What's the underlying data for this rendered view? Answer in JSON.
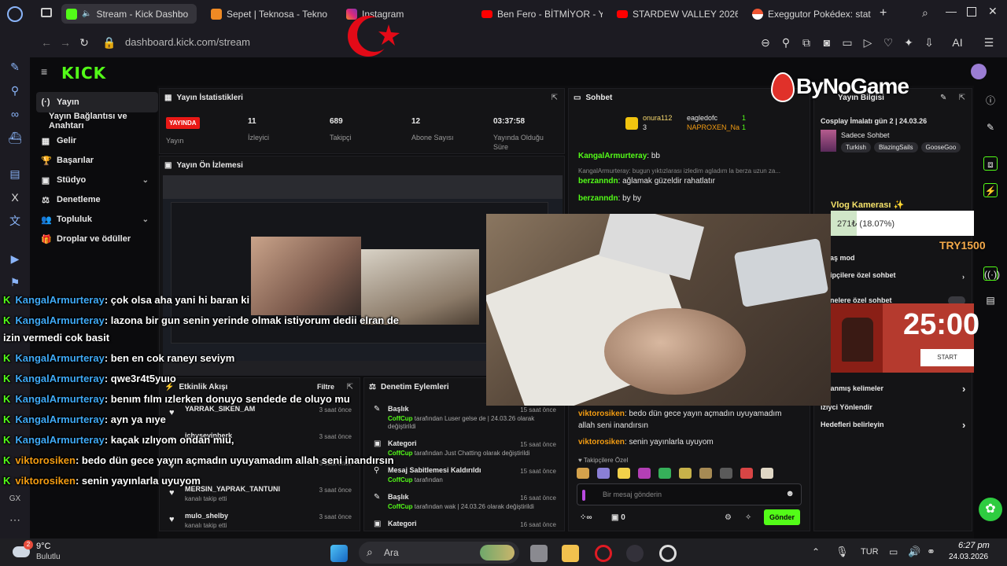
{
  "browser": {
    "tabs": [
      {
        "title": "Stream - Kick Dashbo",
        "active": true
      },
      {
        "title": "Sepet | Teknosa - Tekno"
      },
      {
        "title": "Instagram"
      },
      {
        "title": "Ben Fero - BİTMİYOR - Y"
      },
      {
        "title": "STARDEW VALLEY 2026"
      },
      {
        "title": "Exeggutor Pokédex: stat"
      }
    ],
    "url": "dashboard.kick.com/stream",
    "ai_label": "AI"
  },
  "kick": {
    "logo": "KICK",
    "nav": [
      {
        "label": "Yayın",
        "icon": "(·)",
        "active": true
      },
      {
        "label": "Yayın Bağlantısı ve Anahtarı",
        "icon": ""
      },
      {
        "label": "Gelir",
        "icon": "▦"
      },
      {
        "label": "Başarılar",
        "icon": "🏆"
      },
      {
        "label": "Stüdyo",
        "icon": "▣",
        "chevron": true
      },
      {
        "label": "Denetleme",
        "icon": "⚖"
      },
      {
        "label": "Topluluk",
        "icon": "👥",
        "chevron": true
      },
      {
        "label": "Droplar ve ödüller",
        "icon": "🎁"
      }
    ]
  },
  "stats": {
    "title": "Yayın İstatistikleri",
    "live_badge": "YAYINDA",
    "live_label": "Yayın",
    "items": [
      {
        "value": "11",
        "label": "İzleyici"
      },
      {
        "value": "689",
        "label": "Takipçi"
      },
      {
        "value": "12",
        "label": "Abone Sayısı"
      },
      {
        "value": "03:37:58",
        "label": "Yayında Olduğu Süre"
      }
    ]
  },
  "preview": {
    "title": "Yayın Ön İzlemesi"
  },
  "activity": {
    "title": "Etkinlik Akışı",
    "filter": "Filtre",
    "rows": [
      {
        "name": "YARRAK_SIKEN_AM",
        "sub": "",
        "time": "3 saat önce"
      },
      {
        "name": "ichyseyinberk",
        "sub": "",
        "time": "3 saat önce"
      },
      {
        "name": "",
        "sub": "",
        "time": "3 saat önce"
      },
      {
        "name": "MERSIN_YAPRAK_TANTUNI",
        "sub": "kanalı takip etti",
        "time": "3 saat önce"
      },
      {
        "name": "mulo_shelby",
        "sub": "kanalı takip etti",
        "time": "3 saat önce"
      }
    ]
  },
  "moderation": {
    "title": "Denetim Eylemleri",
    "rows": [
      {
        "title": "Başlık",
        "user": "CoffCup",
        "desc": "tarafından Luser gelse de | 24.03.26 olarak değiştirildi",
        "time": "15 saat önce"
      },
      {
        "title": "Kategori",
        "user": "CoffCup",
        "desc": "tarafından Just Chatting olarak değiştirildi",
        "time": "15 saat önce"
      },
      {
        "title": "Mesaj Sabitlemesi Kaldırıldı",
        "user": "CoffCup",
        "desc": "tarafından",
        "time": "15 saat önce"
      },
      {
        "title": "Başlık",
        "user": "CoffCup",
        "desc": "tarafından wak | 24.03.26 olarak değiştirildi",
        "time": "16 saat önce"
      },
      {
        "title": "Kategori",
        "user": "",
        "desc": "",
        "time": "16 saat önce"
      }
    ]
  },
  "chat": {
    "title": "Sohbet",
    "leaders": [
      "onura112",
      "eagledofc",
      "NAPROXEN_Na"
    ],
    "leader_counts": [
      "3",
      "1",
      "1"
    ],
    "messages": [
      {
        "user": "KangalArmurteray",
        "text": ": bb"
      },
      {
        "user": "berzanndn",
        "text": ": ağlamak güzeldir rahatlatır"
      },
      {
        "user": "berzanndn",
        "text": ": by by"
      }
    ],
    "reply_text": "KangalArmurteray: bugun yıktızlarası izledim agladım la berza uzun za...",
    "lower_messages": [
      {
        "user": "viktorosiken",
        "text": ": bedo dün gece yayın açmadın uyuyamadım allah seni inandırsın"
      },
      {
        "user": "viktorosiken",
        "text": ": senin yayınlarla uyuyom"
      }
    ],
    "followers_only": "Takipçilere Özel",
    "input_placeholder": "Bir mesaj gönderin",
    "send_label": "Gönder",
    "counter_left": "∞",
    "counter_right": "0"
  },
  "settings": {
    "title": "Yayın Bilgisi",
    "stream_title": "Cosplay İmalatı gün 2 | 24.03.26",
    "category": "Sadece Sohbet",
    "tags": [
      "Turkish",
      "BlazingSails",
      "GooseGoo"
    ],
    "rows": [
      "aş mod",
      "ipçilere özel sohbet",
      "nelere özel sohbet",
      "aklanmış kelimeler",
      "iziyci Yönlendir",
      "Hedefleri belirleyin"
    ]
  },
  "overlays": {
    "vlog_label": "Vlog Kamerası ✨",
    "donation": "271₺ (18.07%)",
    "try_goal": "TRY1500",
    "timer": "25:00",
    "timer_btn": "START",
    "brand": "ByNoGame",
    "chat_lines": [
      {
        "user": "KangalArmurteray",
        "text": ": çok olsa aha yani hi baran ki"
      },
      {
        "user": "KangalArmurteray",
        "text": ": lazona bir gun senin yerinde olmak istiyorum dedii elran de"
      },
      {
        "user": "",
        "text": "izin vermedi cok basit"
      },
      {
        "user": "KangalArmurteray",
        "text": ": ben en cok raneyı seviym"
      },
      {
        "user": "KangalArmurteray",
        "text": ": qwe3r4t5yuıo"
      },
      {
        "user": "KangalArmurteray",
        "text": ": benım fılm ızlerken donuyo sendede de oluyo mu"
      },
      {
        "user": "KangalArmurteray",
        "text": ": ayn ya nıye"
      },
      {
        "user": "KangalArmurteray",
        "text": ": kaçak ızlıyom ondan mıu,"
      },
      {
        "user": "viktorosiken",
        "text": ": bedo dün gece yayın açmadın uyuyamadım allah seni inandırsın"
      },
      {
        "user": "viktorosiken",
        "text": ": senin yayınlarla uyuyom"
      }
    ]
  },
  "taskbar": {
    "weather_temp": "9°C",
    "weather_desc": "Bulutlu",
    "weather_badge": "2",
    "search_placeholder": "Ara",
    "lang": "TUR",
    "time": "6:27 pm",
    "date": "24.03.2026"
  },
  "colors": {
    "kick_green": "#53fc18",
    "live_red": "#e91916",
    "chat_blue": "#3fa9f5",
    "chat_orange": "#f39c12"
  }
}
